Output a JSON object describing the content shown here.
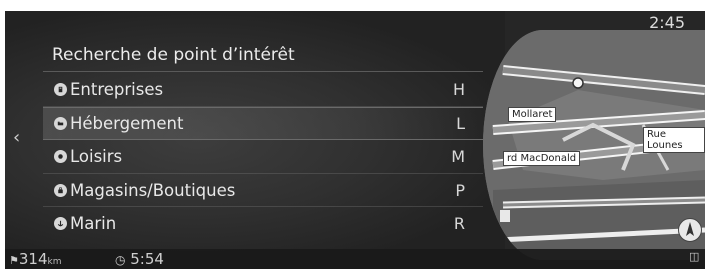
{
  "header": {
    "clock": "2:45"
  },
  "menu": {
    "title": "Recherche de point d’intérêt",
    "items": [
      {
        "label": "Entreprises",
        "letter": "H",
        "icon": "building-icon"
      },
      {
        "label": "Hébergement",
        "letter": "L",
        "icon": "bed-icon"
      },
      {
        "label": "Loisirs",
        "letter": "M",
        "icon": "leisure-icon"
      },
      {
        "label": "Magasins/Boutiques",
        "letter": "P",
        "icon": "shopping-bag-icon"
      },
      {
        "label": "Marin",
        "letter": "R",
        "icon": "anchor-icon"
      }
    ],
    "selected_index": 1
  },
  "map": {
    "street_labels": [
      "Mollaret",
      "rd MacDonald",
      "Rue Lounes"
    ]
  },
  "status": {
    "distance_value": "314",
    "distance_unit": "km",
    "time": "5:54"
  },
  "colors": {
    "screen_bg": "#262626",
    "map_bg": "#6c6c6c",
    "text": "#e8e8e8"
  }
}
